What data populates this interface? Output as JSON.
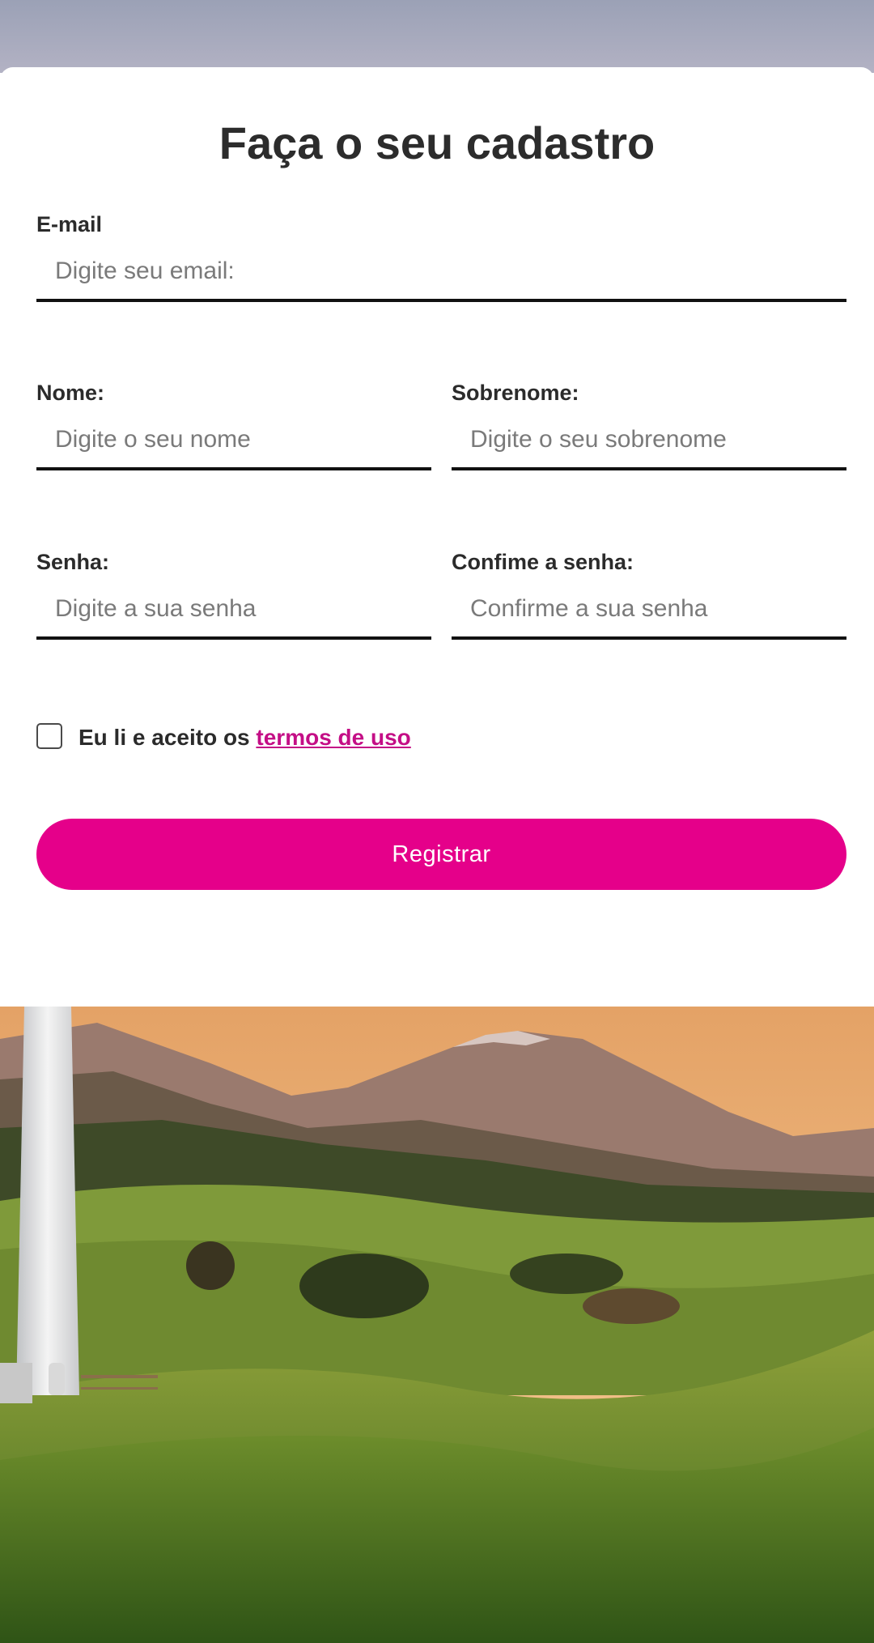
{
  "form": {
    "title": "Faça o seu cadastro",
    "email": {
      "label": "E-mail",
      "placeholder": "Digite seu email:"
    },
    "first_name": {
      "label": "Nome:",
      "placeholder": "Digite o seu nome"
    },
    "last_name": {
      "label": "Sobrenome:",
      "placeholder": "Digite o seu sobrenome"
    },
    "password": {
      "label": "Senha:",
      "placeholder": "Digite a sua senha"
    },
    "confirm_password": {
      "label": "Confime a senha:",
      "placeholder": "Confirme a sua senha"
    },
    "terms": {
      "prefix": "Eu li e aceito os ",
      "link_label": "termos de uso",
      "checked": false
    },
    "submit_label": "Registrar"
  },
  "colors": {
    "accent": "#e5008a",
    "link": "#c40e86",
    "text": "#2b2b2b",
    "underline": "#111111"
  },
  "icons": {
    "checkbox": "checkbox-unchecked-icon"
  }
}
